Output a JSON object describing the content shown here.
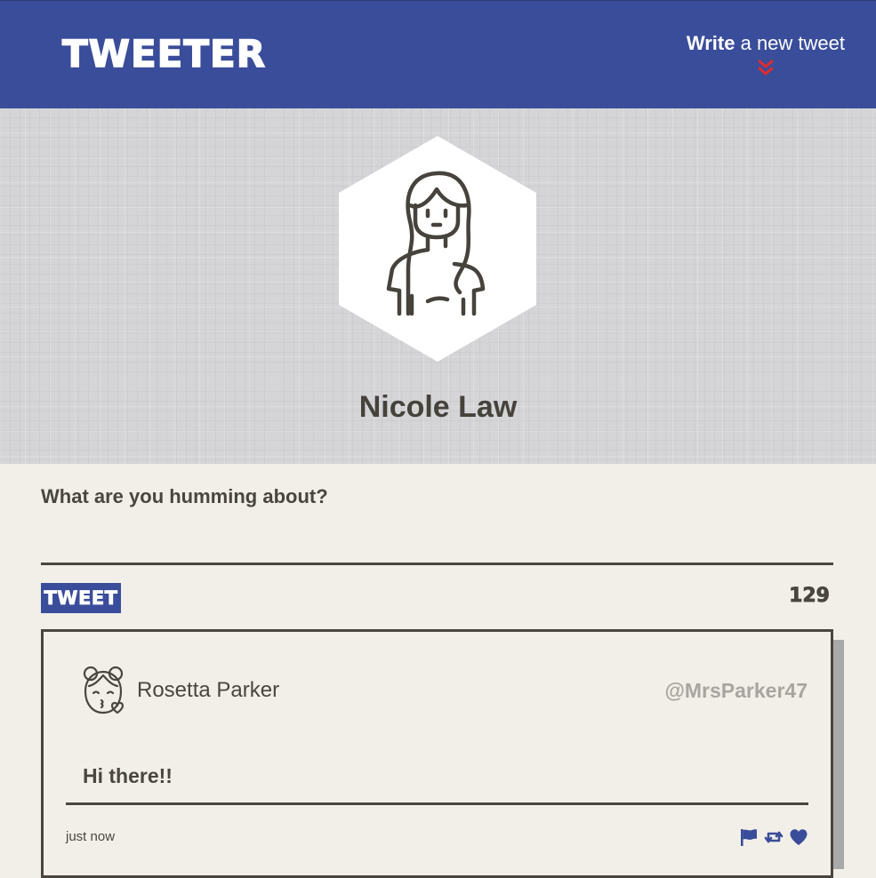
{
  "nav": {
    "brand": "TWEETER",
    "write_strong": "Write",
    "write_rest": " a new tweet",
    "write_arrow_icon": "double-chevron-down-icon",
    "colors": {
      "nav_bg": "#3a4d9a",
      "arrow": "#e02b2b"
    }
  },
  "profile": {
    "name": "Nicole Law",
    "avatar_icon": "woman-avatar-icon"
  },
  "compose": {
    "label": "What are you humming about?",
    "value": "",
    "placeholder": "",
    "button_label": "TWEET",
    "counter": "129"
  },
  "tweet": {
    "author": "Rosetta Parker",
    "handle": "@MrsParker47",
    "avatar_icon": "girl-kiss-avatar-icon",
    "content": "Hi there!!",
    "time": "just now",
    "actions": [
      "flag-icon",
      "retweet-icon",
      "heart-icon"
    ],
    "colors": {
      "action": "#3a4d9a",
      "handle": "#a8a5a0"
    }
  }
}
